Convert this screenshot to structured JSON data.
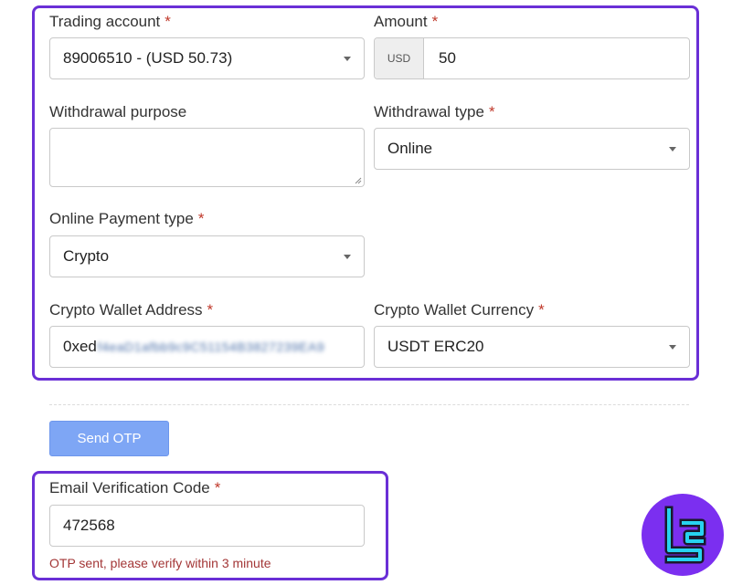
{
  "form": {
    "trading_account": {
      "label": "Trading account",
      "required_mark": "*",
      "value": "89006510 - (USD 50.73)"
    },
    "amount": {
      "label": "Amount",
      "required_mark": "*",
      "currency_addon": "USD",
      "value": "50"
    },
    "withdrawal_purpose": {
      "label": "Withdrawal purpose",
      "value": ""
    },
    "withdrawal_type": {
      "label": "Withdrawal type",
      "required_mark": "*",
      "value": "Online"
    },
    "online_payment_type": {
      "label": "Online Payment type",
      "required_mark": "*",
      "value": "Crypto"
    },
    "crypto_wallet_address": {
      "label": "Crypto Wallet Address",
      "required_mark": "*",
      "value_visible_prefix": "0xed",
      "value_obscured": "f4eaD1afbb9c9C51154B3827239EA9"
    },
    "crypto_wallet_currency": {
      "label": "Crypto Wallet Currency",
      "required_mark": "*",
      "value": "USDT ERC20"
    }
  },
  "send_otp": {
    "label": "Send OTP"
  },
  "verification": {
    "label": "Email Verification Code",
    "required_mark": "*",
    "value": "472568",
    "hint": "OTP sent, please verify within 3 minute"
  },
  "colors": {
    "highlight_frame": "#6a2fd6",
    "button": "#7ea6f5",
    "required": "#c0392b",
    "hint": "#a33636",
    "logo_bg": "#7b2ff0",
    "logo_fg": "#27d3f0"
  },
  "icons": {
    "select_caret": "chevron-down-icon",
    "brand_logo": "tradingfinder-logo-icon"
  }
}
